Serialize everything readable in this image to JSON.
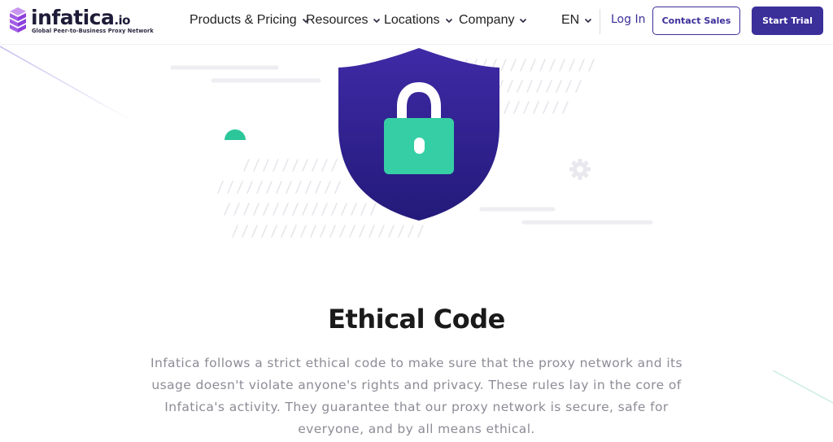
{
  "header": {
    "logo_text": "infatica",
    "logo_suffix": ".io",
    "logo_tagline": "Global Peer-to-Business Proxy Network",
    "nav": [
      {
        "label": "Products & Pricing"
      },
      {
        "label": "Resources"
      },
      {
        "label": "Locations"
      },
      {
        "label": "Company"
      }
    ],
    "language": "EN",
    "login_label": "Log In",
    "contact_label": "Contact Sales",
    "trial_label": "Start Trial"
  },
  "hero": {
    "illustration": [
      "shield-icon",
      "lock-icon",
      "gear-icon"
    ]
  },
  "section": {
    "title": "Ethical Code",
    "body": "Infatica follows a strict ethical code to make sure that the proxy network and its usage doesn't violate anyone's rights and privacy. These rules lay in the core of Infatica's activity. They guarantee that our proxy network is secure, safe for everyone, and by all means ethical."
  },
  "colors": {
    "brand": "#3b2f9a",
    "shield_top": "#3f2aa6",
    "shield_bottom": "#231a7a",
    "lock": "#36cfa5",
    "text_muted": "#8c8c96"
  }
}
